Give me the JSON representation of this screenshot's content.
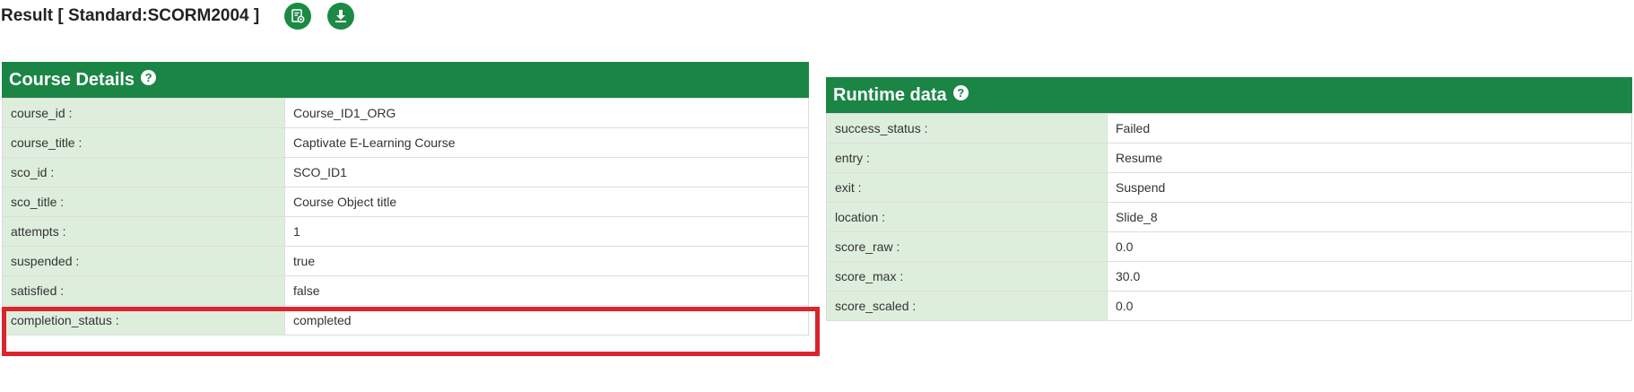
{
  "header": {
    "title": "Result [ Standard:SCORM2004 ]",
    "actions": [
      {
        "icon": "view-report-icon"
      },
      {
        "icon": "download-icon"
      }
    ]
  },
  "course_details": {
    "title": "Course Details",
    "help_glyph": "?",
    "rows": [
      {
        "key": "course_id :",
        "value": "Course_ID1_ORG"
      },
      {
        "key": "course_title :",
        "value": "Captivate E-Learning Course"
      },
      {
        "key": "sco_id :",
        "value": "SCO_ID1"
      },
      {
        "key": "sco_title :",
        "value": "Course Object title"
      },
      {
        "key": "attempts :",
        "value": "1"
      },
      {
        "key": "suspended :",
        "value": "true"
      },
      {
        "key": "satisfied :",
        "value": "false"
      },
      {
        "key": "completion_status :",
        "value": "completed"
      }
    ]
  },
  "runtime_data": {
    "title": "Runtime data",
    "help_glyph": "?",
    "rows": [
      {
        "key": "success_status :",
        "value": "Failed"
      },
      {
        "key": "entry :",
        "value": "Resume"
      },
      {
        "key": "exit :",
        "value": "Suspend"
      },
      {
        "key": "location :",
        "value": "Slide_8"
      },
      {
        "key": "score_raw :",
        "value": "0.0"
      },
      {
        "key": "score_max :",
        "value": "30.0"
      },
      {
        "key": "score_scaled :",
        "value": "0.0"
      }
    ]
  },
  "colors": {
    "panel_header": "#1b8545",
    "key_cell": "#deeedd",
    "highlight": "#d9252e"
  }
}
